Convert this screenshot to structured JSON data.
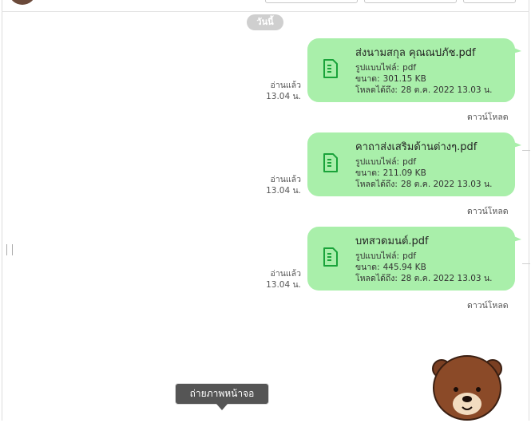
{
  "header": {
    "date_label": "วันนี้"
  },
  "messages": [
    {
      "file_name": "ส่งนามสกุล คุณณปภัช.pdf",
      "format_label": "รูปแบบไฟล์:",
      "format_value": "pdf",
      "size_label": "ขนาด:",
      "size_value": "301.15 KB",
      "expiry_label": "โหลดได้ถึง:",
      "expiry_value": "28 ต.ค. 2022 13.03 น.",
      "read_label": "อ่านแล้ว",
      "time": "13.04 น.",
      "download_label": "ดาวน์โหลด"
    },
    {
      "file_name": "คาถาส่งเสริมด้านต่างๆ.pdf",
      "format_label": "รูปแบบไฟล์:",
      "format_value": "pdf",
      "size_label": "ขนาด:",
      "size_value": "211.09 KB",
      "expiry_label": "โหลดได้ถึง:",
      "expiry_value": "28 ต.ค. 2022 13.03 น.",
      "read_label": "อ่านแล้ว",
      "time": "13.04 น.",
      "download_label": "ดาวน์โหลด"
    },
    {
      "file_name": "บทสวดมนต์.pdf",
      "format_label": "รูปแบบไฟล์:",
      "format_value": "pdf",
      "size_label": "ขนาด:",
      "size_value": "445.94 KB",
      "expiry_label": "โหลดได้ถึง:",
      "expiry_value": "28 ต.ค. 2022 13.03 น.",
      "read_label": "อ่านแล้ว",
      "time": "13.04 น.",
      "download_label": "ดาวน์โหลด"
    }
  ],
  "tooltip": {
    "label": "ถ่ายภาพหน้าจอ"
  },
  "icons": {
    "file": "file-document-icon",
    "sticker": "bear-sticker-icon",
    "grip": "resize-grip-icon"
  },
  "colors": {
    "bubble": "#a9efaa",
    "icon": "#1aa33a",
    "date_pill": "#cfcfcf",
    "tooltip": "#555555"
  }
}
